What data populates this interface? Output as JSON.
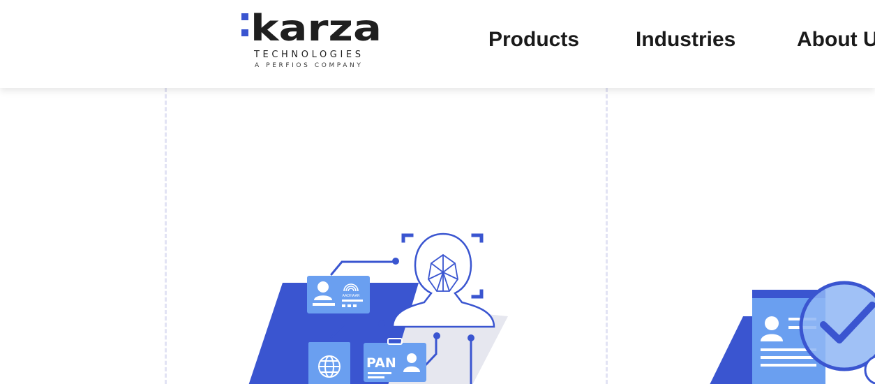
{
  "header": {
    "logo": {
      "wordmark": "karza",
      "line1": "TECHNOLOGIES",
      "line2": "A PERFIOS COMPANY"
    },
    "nav": [
      {
        "label": "Products"
      },
      {
        "label": "Industries"
      },
      {
        "label": "About U"
      }
    ]
  },
  "illustrations": {
    "kyc": {
      "card_text": "PAN",
      "badge_text": "AADHAAR"
    }
  },
  "colors": {
    "brand_blue": "#3a55d0",
    "light_blue": "#6a9ff0",
    "dashed_border": "#e2e3f4",
    "nav_text": "#1a1a1a"
  },
  "icons": [
    "face-scan-icon",
    "globe-icon",
    "user-card-icon",
    "check-badge-icon"
  ]
}
